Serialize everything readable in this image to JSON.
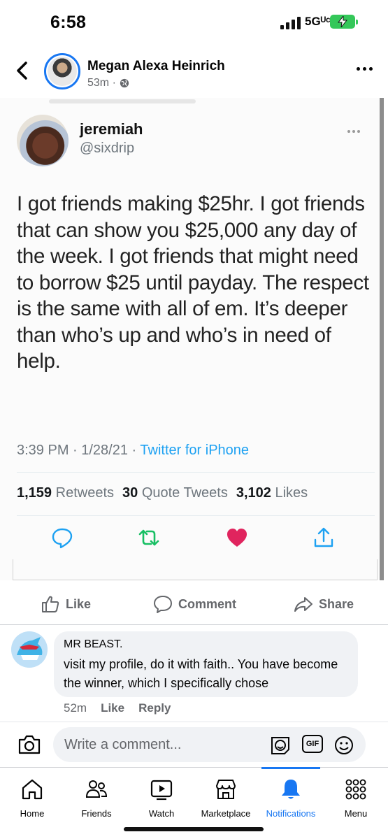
{
  "status_bar": {
    "time": "6:58",
    "network": "5Gᵁᶜ"
  },
  "header": {
    "poster_name": "Megan Alexa Heinrich",
    "post_age": "53m ·"
  },
  "tweet": {
    "name": "jeremiah",
    "handle": "@sixdrip",
    "text": "I got friends making $25hr. I got friends that can show you $25,000 any day of the week. I got friends that might need to borrow $25 until payday. The respect is the same with all of em. It’s deeper than who’s up and who’s in need of help.",
    "time": "3:39 PM · 1/28/21 · ",
    "source": "Twitter for iPhone",
    "retweets_count": "1,159",
    "retweets_label": "Retweets",
    "quotes_count": "30",
    "quotes_label": "Quote Tweets",
    "likes_count": "3,102",
    "likes_label": "Likes"
  },
  "reactions": {
    "like": "Like",
    "comment": "Comment",
    "share": "Share"
  },
  "comment": {
    "author": "MR BEAST.",
    "text": "visit my profile, do it with faith.. You have become the winner, which I specifically chose",
    "age": "52m",
    "like": "Like",
    "reply": "Reply"
  },
  "composer": {
    "placeholder": "Write a comment...",
    "gif": "GIF"
  },
  "nav": {
    "home": "Home",
    "friends": "Friends",
    "watch": "Watch",
    "marketplace": "Marketplace",
    "notifications": "Notifications",
    "menu": "Menu"
  },
  "colors": {
    "accent": "#1877f2",
    "twitter_blue": "#1da1f2",
    "retweet_green": "#17bf63",
    "like_red": "#e0245e"
  }
}
